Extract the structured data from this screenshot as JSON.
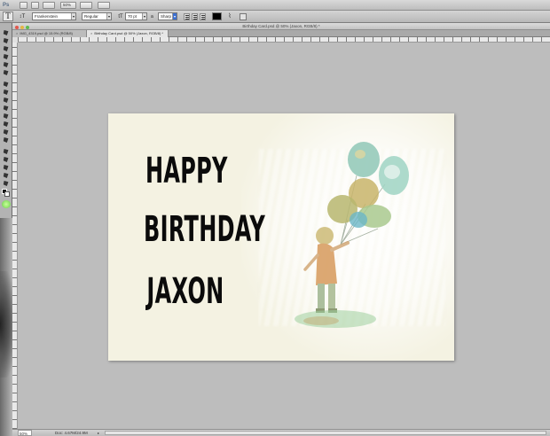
{
  "app": {
    "logo": "Ps",
    "zoom": "50%",
    "workspace": ""
  },
  "options": {
    "font_family": "Frankenstein",
    "font_style": "Regular",
    "font_size": "70 pt",
    "anti_alias_label": "a",
    "anti_alias": "Sharp",
    "text_color": "#000000"
  },
  "document": {
    "window_title": "Birthday Card.psd @ 50% (Jaxon, RGB/8) *",
    "tabs": [
      {
        "label": "IMG_4319.psd @ 15.9% (RGB/8)"
      },
      {
        "label": "Birthday Card.psd @ 50% (Jaxon, RGB/8) *"
      }
    ]
  },
  "card": {
    "line1": "HAPPY",
    "line2": "BIRTHDAY",
    "line3": "JAXON",
    "background": "#f4f2e2",
    "text_color": "#0b0b0b"
  },
  "status": {
    "zoom": "50%",
    "doc_info": "Doc: 4.67M/24.9M"
  }
}
